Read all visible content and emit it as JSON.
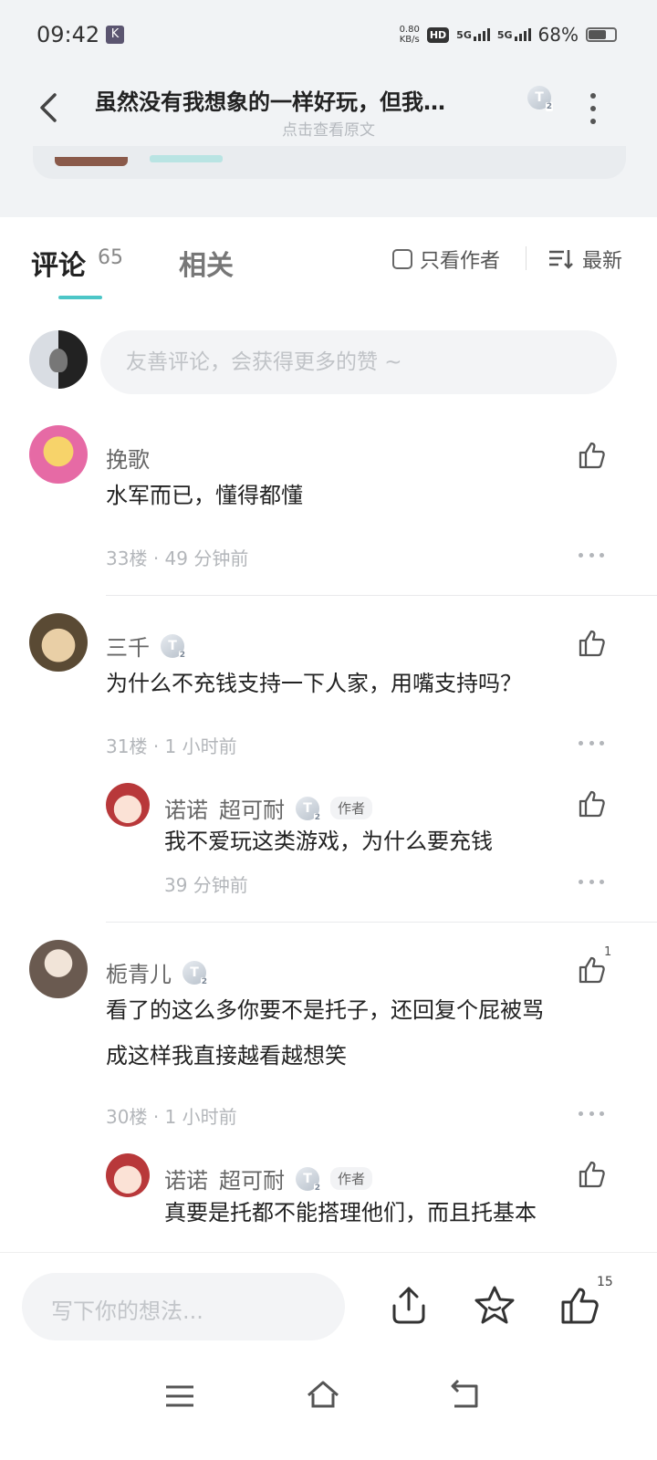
{
  "status_bar": {
    "time": "09:42",
    "app_badge": "K",
    "net_speed_value": "0.80",
    "net_speed_unit": "KB/s",
    "hd": "HD",
    "sim1": "5G",
    "sim2": "5G",
    "battery_text": "68%",
    "battery_level": 0.68
  },
  "header": {
    "title": "虽然没有我想象的一样好玩，但我…",
    "subtitle": "点击查看原文",
    "badge": "T"
  },
  "tabs": {
    "comments_label": "评论",
    "comments_count": "65",
    "related_label": "相关",
    "author_only_label": "只看作者",
    "sort_label": "最新"
  },
  "composer": {
    "placeholder": "友善评论，会获得更多的赞 ~"
  },
  "comments": [
    {
      "name": "挽歌",
      "text": "水军而已，懂得都懂",
      "floor": "33楼",
      "time": "49 分钟前"
    },
    {
      "name": "三千",
      "text": "为什么不充钱支持一下人家，用嘴支持吗？",
      "floor": "31楼",
      "time": "1 小时前",
      "reply": {
        "name": "诺诺",
        "name2": "超可耐",
        "tag": "作者",
        "text": "我不爱玩这类游戏，为什么要充钱",
        "time": "39 分钟前"
      }
    },
    {
      "name": "栀青儿",
      "likes": "1",
      "text_line1": "看了的这么多你要不是托子，还回复个屁被骂",
      "text_line2": "成这样我直接越看越想笑",
      "floor": "30楼",
      "time": "1 小时前",
      "reply": {
        "name": "诺诺",
        "name2": "超可耐",
        "tag": "作者",
        "text": "真要是托都不能搭理他们，而且托基本"
      }
    }
  ],
  "meta_separator": "·",
  "bottom_bar": {
    "placeholder": "写下你的想法...",
    "like_count": "15"
  },
  "colors": {
    "accent": "#4cc6c7",
    "background_top": "#f1f3f5"
  }
}
